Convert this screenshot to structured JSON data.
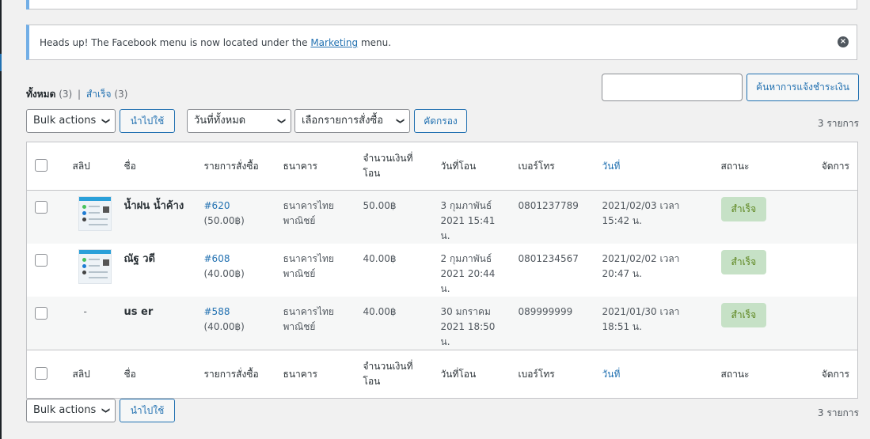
{
  "notice": {
    "text_before": "Heads up! The Facebook menu is now located under the ",
    "link": "Marketing",
    "text_after": " menu.",
    "dismiss_icon": "dismiss-icon"
  },
  "views": {
    "all_label": "ทั้งหมด",
    "all_count": "(3)",
    "sep": "|",
    "success_label": "สำเร็จ",
    "success_count": "(3)"
  },
  "search": {
    "button": "ค้นหาการแจ้งชำระเงิน",
    "value": ""
  },
  "filters": {
    "bulk_top": "Bulk actions",
    "apply_top": "นำไปใช้",
    "date": "วันที่ทั้งหมด",
    "order": "เลือกรายการสั่งซื้อ",
    "filter_btn": "คัดกรอง",
    "bulk_bottom": "Bulk actions",
    "apply_bottom": "นำไปใช้"
  },
  "count_top": "3 รายการ",
  "count_bottom": "3 รายการ",
  "columns": {
    "slip": "สลิป",
    "name": "ชื่อ",
    "order": "รายการสั่งซื้อ",
    "bank": "ธนาคาร",
    "amount": "จำนวนเงินที่โอน",
    "transfer_date": "วันที่โอน",
    "phone": "เบอร์โทร",
    "date": "วันที่",
    "status": "สถานะ",
    "actions": "จัดการ"
  },
  "rows": [
    {
      "slip": "",
      "name": "น้ำฝน น้ำค้าง",
      "order_no": "#620",
      "order_total": "(50.00฿)",
      "bank": "ธนาคารไทยพาณิชย์",
      "amount": "50.00฿",
      "transfer_date": "3 กุมภาพันธ์ 2021 15:41 น.",
      "phone": "0801237789",
      "date": "2021/02/03 เวลา 15:42 น.",
      "status": "สำเร็จ"
    },
    {
      "slip": "",
      "name": "ณัฐ วดี",
      "order_no": "#608",
      "order_total": "(40.00฿)",
      "bank": "ธนาคารไทยพาณิชย์",
      "amount": "40.00฿",
      "transfer_date": "2 กุมภาพันธ์ 2021 20:44 น.",
      "phone": "0801234567",
      "date": "2021/02/02 เวลา 20:47 น.",
      "status": "สำเร็จ"
    },
    {
      "slip": "-",
      "name": "us er",
      "order_no": "#588",
      "order_total": "(40.00฿)",
      "bank": "ธนาคารไทยพาณิชย์",
      "amount": "40.00฿",
      "transfer_date": "30 มกราคม 2021 18:50 น.",
      "phone": "089999999",
      "date": "2021/01/30 เวลา 18:51 น.",
      "status": "สำเร็จ"
    }
  ],
  "colors": {
    "accent": "#2271b1",
    "status_bg": "#c6e1c6",
    "status_text": "#5b841b"
  }
}
